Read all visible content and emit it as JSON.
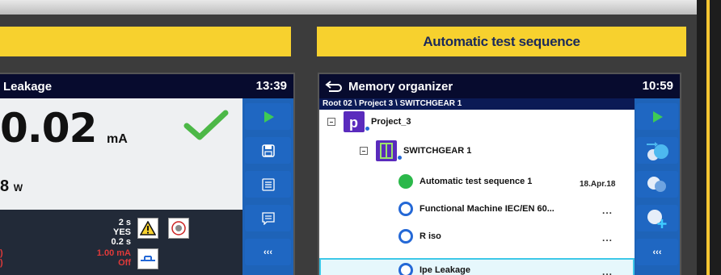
{
  "headers": {
    "left_title": "",
    "right_title": "Automatic test sequence"
  },
  "left_device": {
    "title": "Leakage",
    "clock": "13:39",
    "main_value": "0.02",
    "main_unit": "mA",
    "sub_value": "8",
    "sub_unit": "W",
    "params_white": [
      "2 s",
      "YES",
      "0.2 s"
    ],
    "params_red": [
      "1.00 mA",
      "Off"
    ],
    "red_left": [
      ")",
      ")"
    ],
    "side_buttons": [
      "play-icon",
      "save-icon",
      "list-icon",
      "comment-icon",
      "collapse-icon"
    ],
    "collapse_label": "‹‹‹"
  },
  "right_device": {
    "title": "Memory organizer",
    "clock": "10:59",
    "path": "Root 02 \\ Project 3 \\ SWITCHGEAR 1",
    "tree": {
      "project": "Project_3",
      "switchgear": "SWITCHGEAR 1",
      "items": [
        {
          "label": "Automatic test sequence 1",
          "status": "passed",
          "meta": "18.Apr.18"
        },
        {
          "label": "Functional Machine IEC/EN 60...",
          "status": "empty",
          "meta": "..."
        },
        {
          "label": "R iso",
          "status": "empty",
          "meta": "..."
        },
        {
          "label": "Ipe Leakage",
          "status": "empty",
          "meta": "..."
        }
      ]
    },
    "side_buttons": [
      "play-icon",
      "move-nodes-icon",
      "clone-nodes-icon",
      "add-node-icon",
      "collapse-icon"
    ],
    "collapse_label": "‹‹‹"
  },
  "colors": {
    "accent_yellow": "#f7d12e",
    "side_blue": "#1e63b8",
    "title_navy": "#070b2e",
    "pass_green": "#2bb84a",
    "select_cyan": "#3ec8e8"
  }
}
